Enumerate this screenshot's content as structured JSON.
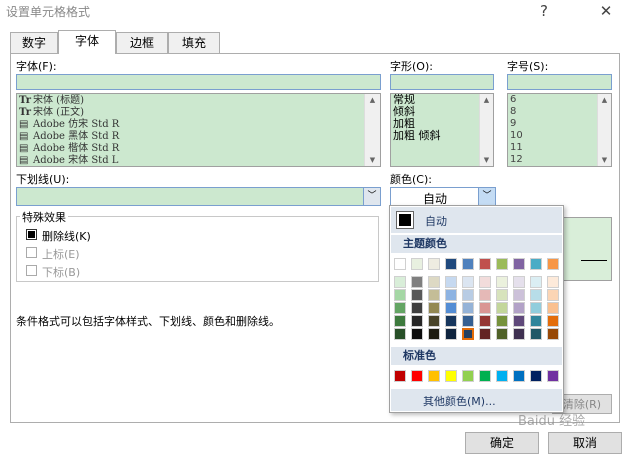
{
  "window": {
    "title": "设置单元格格式",
    "help_button": "?",
    "close_button": "✕"
  },
  "tabs": [
    "数字",
    "字体",
    "边框",
    "填充"
  ],
  "active_tab": 1,
  "font": {
    "label": "字体(F):",
    "items": [
      {
        "icon": "Tr",
        "name": "宋体 (标题)"
      },
      {
        "icon": "Tr",
        "name": "宋体 (正文)"
      },
      {
        "icon": "▤",
        "name": "Adobe 仿宋 Std R"
      },
      {
        "icon": "▤",
        "name": "Adobe 黑体 Std R"
      },
      {
        "icon": "▤",
        "name": "Adobe 楷体 Std R"
      },
      {
        "icon": "▤",
        "name": "Adobe 宋体 Std L"
      }
    ]
  },
  "style": {
    "label": "字形(O):",
    "items": [
      "常规",
      "倾斜",
      "加粗",
      "加粗 倾斜"
    ]
  },
  "size": {
    "label": "字号(S):",
    "items": [
      "6",
      "8",
      "9",
      "10",
      "11",
      "12"
    ]
  },
  "underline": {
    "label": "下划线(U):",
    "value": ""
  },
  "color": {
    "label": "颜色(C):",
    "value": "自动"
  },
  "effects": {
    "legend": "特殊效果",
    "items": [
      {
        "label": "删除线(K)",
        "checked": true,
        "enabled": true
      },
      {
        "label": "上标(E)",
        "checked": false,
        "enabled": false
      },
      {
        "label": "下标(B)",
        "checked": false,
        "enabled": false
      }
    ]
  },
  "info_text": "条件格式可以包括字体样式、下划线、颜色和删除线。",
  "popup": {
    "auto_label": "自动",
    "theme_label": "主题颜色",
    "standard_label": "标准色",
    "more_label": "其他颜色(M)...",
    "theme_colors": [
      [
        "#ffffff",
        "#e8f0e0",
        "#eeece1",
        "#1f497d",
        "#4f81bd",
        "#c0504d",
        "#9bbb59",
        "#8064a2",
        "#4bacc6",
        "#f79646"
      ],
      [
        "#d9eed9",
        "#7f7f7f",
        "#ddd9c4",
        "#c6d9f0",
        "#dbe5f1",
        "#f2dcdb",
        "#ebf1dd",
        "#e5e0ec",
        "#dbeef3",
        "#fdeada"
      ],
      [
        "#a5d7a5",
        "#595959",
        "#c4bd97",
        "#8db3e2",
        "#b8cce4",
        "#e5b9b7",
        "#d7e3bc",
        "#ccc1d9",
        "#b7dde8",
        "#fbd5b5"
      ],
      [
        "#64a564",
        "#3f3f3f",
        "#938953",
        "#548dd4",
        "#95b3d7",
        "#d99694",
        "#c3d69b",
        "#b2a2c7",
        "#92cddc",
        "#fac08f"
      ],
      [
        "#3e7a3e",
        "#262626",
        "#494429",
        "#17365d",
        "#366092",
        "#953734",
        "#76923c",
        "#5f497a",
        "#31859b",
        "#e36c09"
      ],
      [
        "#284f28",
        "#0c0c0c",
        "#1d1b10",
        "#0f243e",
        "#244061",
        "#632423",
        "#4f6128",
        "#3f3151",
        "#205867",
        "#974806"
      ]
    ],
    "selected_theme": [
      4,
      5
    ],
    "standard_colors": [
      "#c00000",
      "#ff0000",
      "#ffc000",
      "#ffff00",
      "#92d050",
      "#00b050",
      "#00b0f0",
      "#0070c0",
      "#002060",
      "#7030a0"
    ]
  },
  "buttons": {
    "clear": "清除(R)",
    "ok": "确定",
    "cancel": "取消"
  },
  "watermark": "Baidu 经验"
}
